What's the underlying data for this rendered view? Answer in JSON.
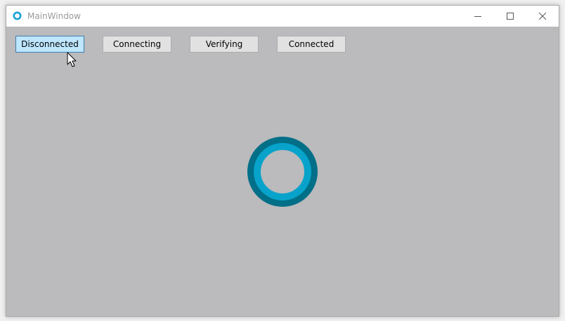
{
  "window": {
    "title": "MainWindow",
    "app_icon": "ring-app-icon"
  },
  "caption_buttons": {
    "minimize_icon": "minimize-icon",
    "maximize_icon": "maximize-icon",
    "close_icon": "close-icon"
  },
  "buttons": [
    {
      "label": "Disconnected",
      "state": "hover"
    },
    {
      "label": "Connecting"
    },
    {
      "label": "Verifying"
    },
    {
      "label": "Connected"
    }
  ],
  "status_indicator": {
    "icon": "ring-status-icon",
    "outer_color": "#006f87",
    "inner_color": "#08a3cb"
  },
  "colors": {
    "client_background": "#bbbabd",
    "button_hover": "#bee6fd",
    "button_default": "#e1e1e1"
  }
}
